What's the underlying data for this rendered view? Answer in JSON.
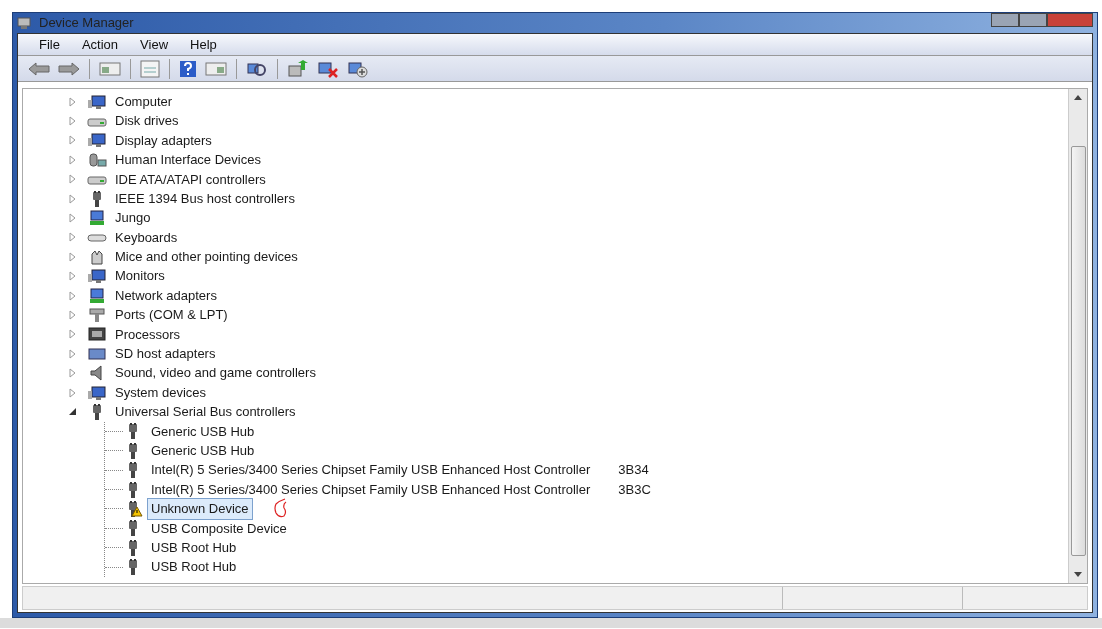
{
  "window": {
    "title": "Device Manager"
  },
  "menu": [
    {
      "label": "File"
    },
    {
      "label": "Action"
    },
    {
      "label": "View"
    },
    {
      "label": "Help"
    }
  ],
  "tree": [
    {
      "label": "Computer",
      "kind": "monitor",
      "expanded": false,
      "selected": false
    },
    {
      "label": "Disk drives",
      "kind": "drive",
      "expanded": false,
      "selected": false
    },
    {
      "label": "Display adapters",
      "kind": "monitor",
      "expanded": false,
      "selected": false
    },
    {
      "label": "Human Interface Devices",
      "kind": "hid",
      "expanded": false,
      "selected": false
    },
    {
      "label": "IDE ATA/ATAPI controllers",
      "kind": "drive",
      "expanded": false,
      "selected": false
    },
    {
      "label": "IEEE 1394 Bus host controllers",
      "kind": "plug",
      "expanded": false,
      "selected": false
    },
    {
      "label": "Jungo",
      "kind": "network",
      "expanded": false,
      "selected": false
    },
    {
      "label": "Keyboards",
      "kind": "keyboard",
      "expanded": false,
      "selected": false
    },
    {
      "label": "Mice and other pointing devices",
      "kind": "mouse",
      "expanded": false,
      "selected": false
    },
    {
      "label": "Monitors",
      "kind": "monitor",
      "expanded": false,
      "selected": false
    },
    {
      "label": "Network adapters",
      "kind": "network",
      "expanded": false,
      "selected": false
    },
    {
      "label": "Ports (COM & LPT)",
      "kind": "port",
      "expanded": false,
      "selected": false
    },
    {
      "label": "Processors",
      "kind": "cpu",
      "expanded": false,
      "selected": false
    },
    {
      "label": "SD host adapters",
      "kind": "card",
      "expanded": false,
      "selected": false
    },
    {
      "label": "Sound, video and game controllers",
      "kind": "speaker",
      "expanded": false,
      "selected": false
    },
    {
      "label": "System devices",
      "kind": "monitor",
      "expanded": false,
      "selected": false
    },
    {
      "label": "Universal Serial Bus controllers",
      "kind": "plug",
      "expanded": true,
      "selected": false,
      "children": [
        {
          "label": "Generic USB Hub",
          "kind": "plug",
          "selected": false,
          "warning": false
        },
        {
          "label": "Generic USB Hub",
          "kind": "plug",
          "selected": false,
          "warning": false
        },
        {
          "label": "Intel(R) 5 Series/3400 Series Chipset Family USB Enhanced Host Controller",
          "note": "3B34",
          "kind": "plug",
          "selected": false,
          "warning": false
        },
        {
          "label": "Intel(R) 5 Series/3400 Series Chipset Family USB Enhanced Host Controller",
          "note": "3B3C",
          "kind": "plug",
          "selected": false,
          "warning": false
        },
        {
          "label": "Unknown Device",
          "kind": "plug",
          "selected": true,
          "warning": true
        },
        {
          "label": "USB Composite Device",
          "kind": "plug",
          "selected": false,
          "warning": false
        },
        {
          "label": "USB Root Hub",
          "kind": "plug",
          "selected": false,
          "warning": false
        },
        {
          "label": "USB Root Hub",
          "kind": "plug",
          "selected": false,
          "warning": false
        }
      ]
    }
  ]
}
